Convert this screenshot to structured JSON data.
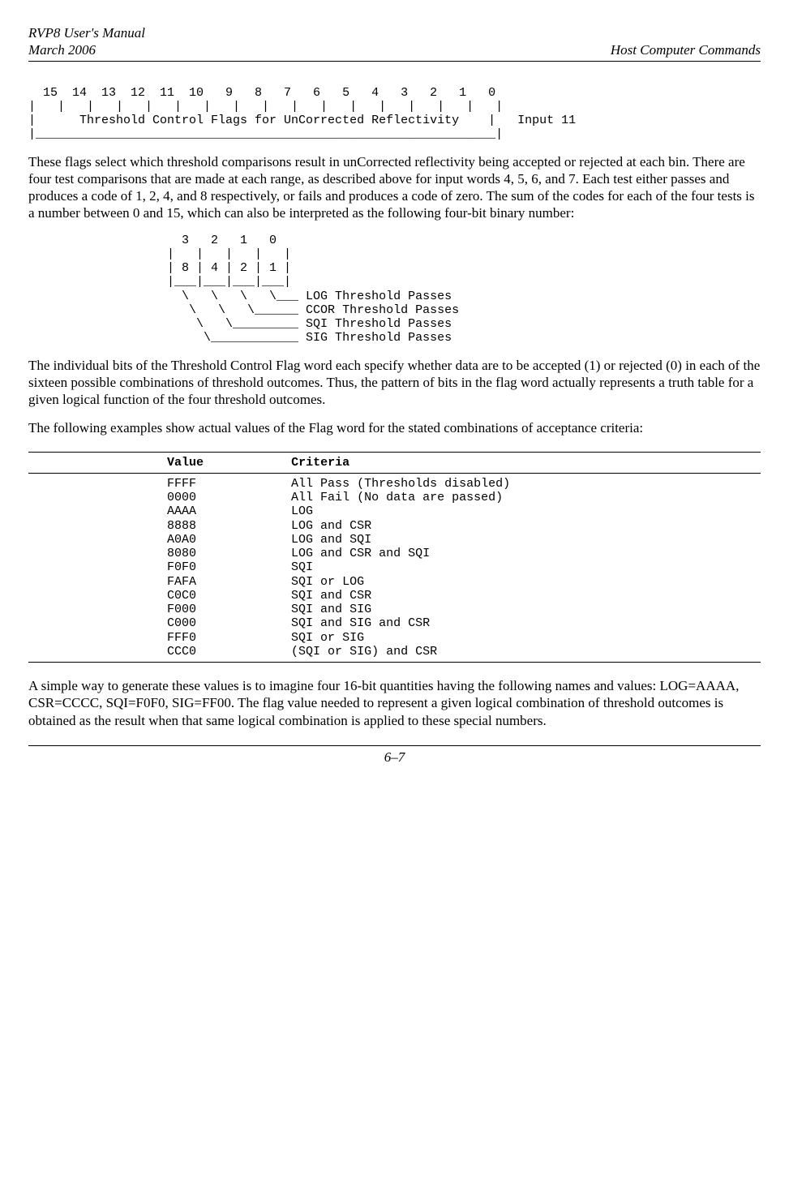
{
  "header": {
    "title_line1": "RVP8 User's Manual",
    "title_line2": "March 2006",
    "right": "Host Computer Commands"
  },
  "diagram1": {
    "bits": "  15  14  13  12  11  10   9   8   7   6   5   4   3   2   1   0  ",
    "bars": "|   |   |   |   |   |   |   |   |   |   |   |   |   |   |   |   |",
    "label": "|      Threshold Control Flags for UnCorrected Reflectivity    |   Input 11",
    "bottom": "|_______________________________________________________________|"
  },
  "para1": "These flags select which threshold comparisons result in unCorrected reflectivity being accepted or rejected at each bin.  There are four test comparisons that are made at each range, as described above for input words 4, 5, 6, and 7.  Each test either passes and produces a code of 1, 2, 4, and 8 respectively, or fails and produces a code of zero.  The sum of the codes for each of the four tests is a number between 0 and 15, which can also be interpreted as the following four-bit binary number:",
  "diagram2": {
    "l1": "                     3   2   1   0  ",
    "l2": "                   |   |   |   |   |",
    "l3": "                   | 8 | 4 | 2 | 1 |",
    "l4": "                   |___|___|___|___|",
    "l5": "                     \\   \\   \\   \\___ LOG Threshold Passes",
    "l6": "                      \\   \\   \\______ CCOR Threshold Passes",
    "l7": "                       \\   \\_________ SQI Threshold Passes",
    "l8": "                        \\____________ SIG Threshold Passes"
  },
  "para2": "The individual bits of the Threshold Control Flag word each specify whether data are to be accepted (1) or rejected (0) in each of the sixteen possible combinations of threshold outcomes.  Thus, the pattern of bits in the flag word actually represents a truth table for a given logical function of the four threshold outcomes.",
  "para3": "The following examples show actual values of the Flag word for the stated combinations of acceptance criteria:",
  "table": {
    "col1_header": "Value",
    "col2_header": "Criteria",
    "rows": [
      {
        "value": "FFFF",
        "criteria": "All Pass (Thresholds disabled)"
      },
      {
        "value": "0000",
        "criteria": "All Fail (No data are passed)"
      },
      {
        "value": "AAAA",
        "criteria": "LOG"
      },
      {
        "value": "8888",
        "criteria": "LOG and CSR"
      },
      {
        "value": "A0A0",
        "criteria": "LOG and SQI"
      },
      {
        "value": "8080",
        "criteria": "LOG and CSR and SQI"
      },
      {
        "value": "F0F0",
        "criteria": "SQI"
      },
      {
        "value": "FAFA",
        "criteria": "SQI or LOG"
      },
      {
        "value": "C0C0",
        "criteria": "SQI and CSR"
      },
      {
        "value": "F000",
        "criteria": "SQI and SIG"
      },
      {
        "value": "C000",
        "criteria": "SQI and SIG and CSR"
      },
      {
        "value": "FFF0",
        "criteria": "SQI or SIG"
      },
      {
        "value": "CCC0",
        "criteria": "(SQI or SIG) and CSR"
      }
    ]
  },
  "para4": "A simple way to generate these values is to imagine four 16-bit quantities having the following names and values: LOG=AAAA, CSR=CCCC, SQI=F0F0, SIG=FF00.  The flag value needed to represent a given logical combination of threshold outcomes is obtained as the result when that same logical combination is applied to these special numbers.",
  "footer": "6–7"
}
